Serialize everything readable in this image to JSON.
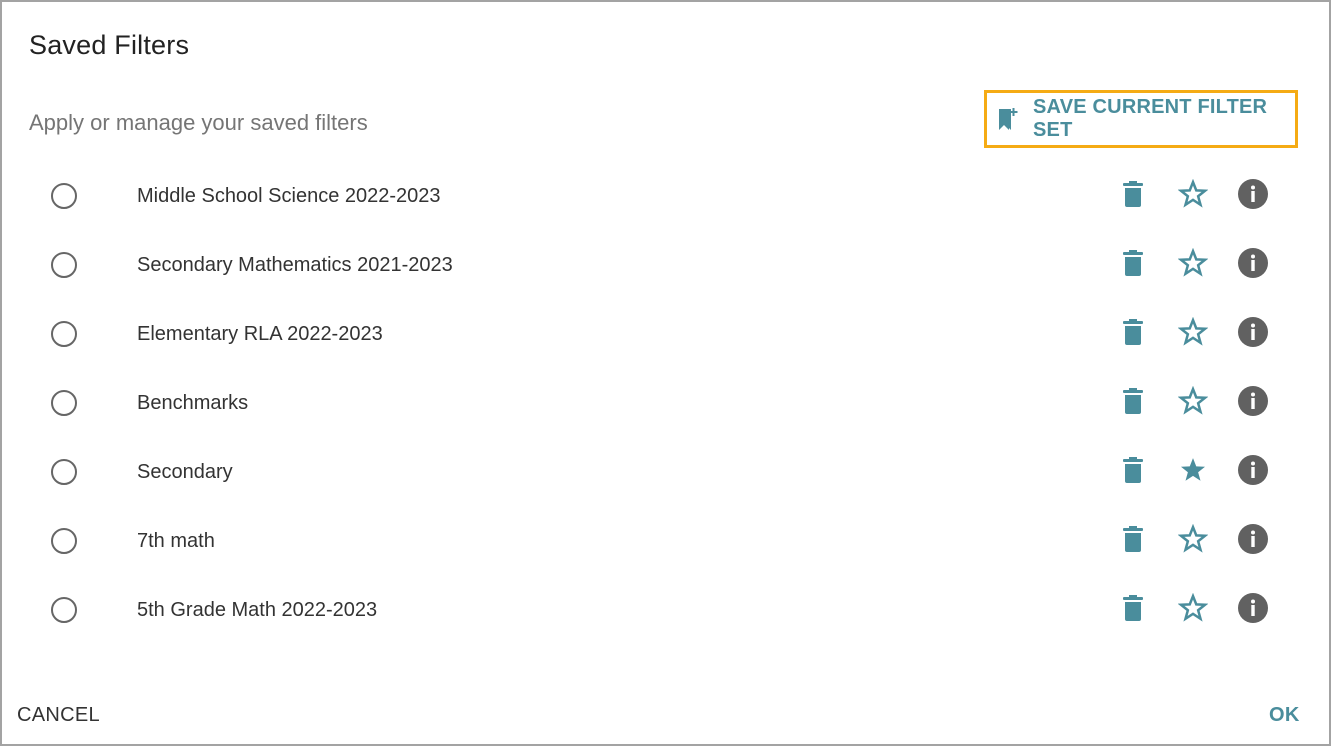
{
  "dialog": {
    "title": "Saved Filters",
    "subtitle": "Apply or manage your saved filters",
    "save_button_label": "SAVE CURRENT FILTER SET",
    "save_button_icon": "bookmark-add-icon",
    "cancel_label": "CANCEL",
    "ok_label": "OK"
  },
  "colors": {
    "accent": "#4a8d9c",
    "focus_outline": "#f5ab14",
    "info_icon": "#616161",
    "text": "#333333",
    "subtitle": "#757575"
  },
  "filters": [
    {
      "label": "Middle School Science 2022-2023",
      "selected": false,
      "favorite": false
    },
    {
      "label": "Secondary Mathematics 2021-2023",
      "selected": false,
      "favorite": false
    },
    {
      "label": "Elementary RLA 2022-2023",
      "selected": false,
      "favorite": false
    },
    {
      "label": "Benchmarks",
      "selected": false,
      "favorite": false
    },
    {
      "label": "Secondary",
      "selected": false,
      "favorite": true
    },
    {
      "label": "7th math",
      "selected": false,
      "favorite": false
    },
    {
      "label": "5th Grade Math 2022-2023",
      "selected": false,
      "favorite": false
    }
  ],
  "row_icons": [
    "trash-icon",
    "star-icon",
    "info-icon"
  ]
}
